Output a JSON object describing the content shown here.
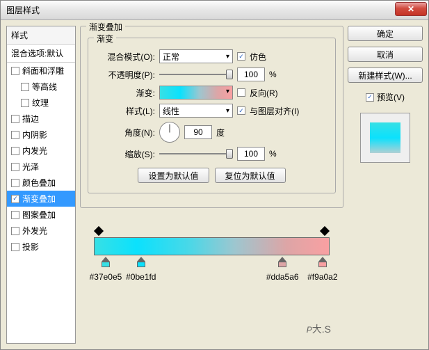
{
  "window": {
    "title": "图层样式"
  },
  "left": {
    "header": "样式",
    "sub": "混合选项:默认",
    "items": [
      {
        "label": "斜面和浮雕",
        "checked": false,
        "indent": false
      },
      {
        "label": "等高线",
        "checked": false,
        "indent": true
      },
      {
        "label": "纹理",
        "checked": false,
        "indent": true
      },
      {
        "label": "描边",
        "checked": false,
        "indent": false
      },
      {
        "label": "内阴影",
        "checked": false,
        "indent": false
      },
      {
        "label": "内发光",
        "checked": false,
        "indent": false
      },
      {
        "label": "光泽",
        "checked": false,
        "indent": false
      },
      {
        "label": "颜色叠加",
        "checked": false,
        "indent": false
      },
      {
        "label": "渐变叠加",
        "checked": true,
        "indent": false,
        "selected": true
      },
      {
        "label": "图案叠加",
        "checked": false,
        "indent": false
      },
      {
        "label": "外发光",
        "checked": false,
        "indent": false
      },
      {
        "label": "投影",
        "checked": false,
        "indent": false
      }
    ]
  },
  "panel": {
    "title": "渐变叠加",
    "subtitle": "渐变",
    "blend_label": "混合模式(O):",
    "blend_value": "正常",
    "dither_label": "仿色",
    "opacity_label": "不透明度(P):",
    "opacity_value": "100",
    "pct": "%",
    "gradient_label": "渐变:",
    "reverse_label": "反向(R)",
    "style_label": "样式(L):",
    "style_value": "线性",
    "align_label": "与图层对齐(I)",
    "angle_label": "角度(N):",
    "angle_value": "90",
    "angle_unit": "度",
    "scale_label": "缩放(S):",
    "scale_value": "100",
    "btn_default": "设置为默认值",
    "btn_reset": "复位为默认值"
  },
  "right": {
    "ok": "确定",
    "cancel": "取消",
    "newstyle": "新建样式(W)...",
    "preview_label": "预览(V)"
  },
  "gradient_stops": {
    "colors": [
      {
        "hex": "#37e0e5",
        "pos": 5
      },
      {
        "hex": "#0be1fd",
        "pos": 20
      },
      {
        "hex": "#dda5a6",
        "pos": 80
      },
      {
        "hex": "#f9a0a2",
        "pos": 97
      }
    ],
    "opacity_stops": [
      {
        "pos": 2
      },
      {
        "pos": 98
      }
    ]
  },
  "watermark": {
    "big": "P",
    "small": "大.S"
  }
}
